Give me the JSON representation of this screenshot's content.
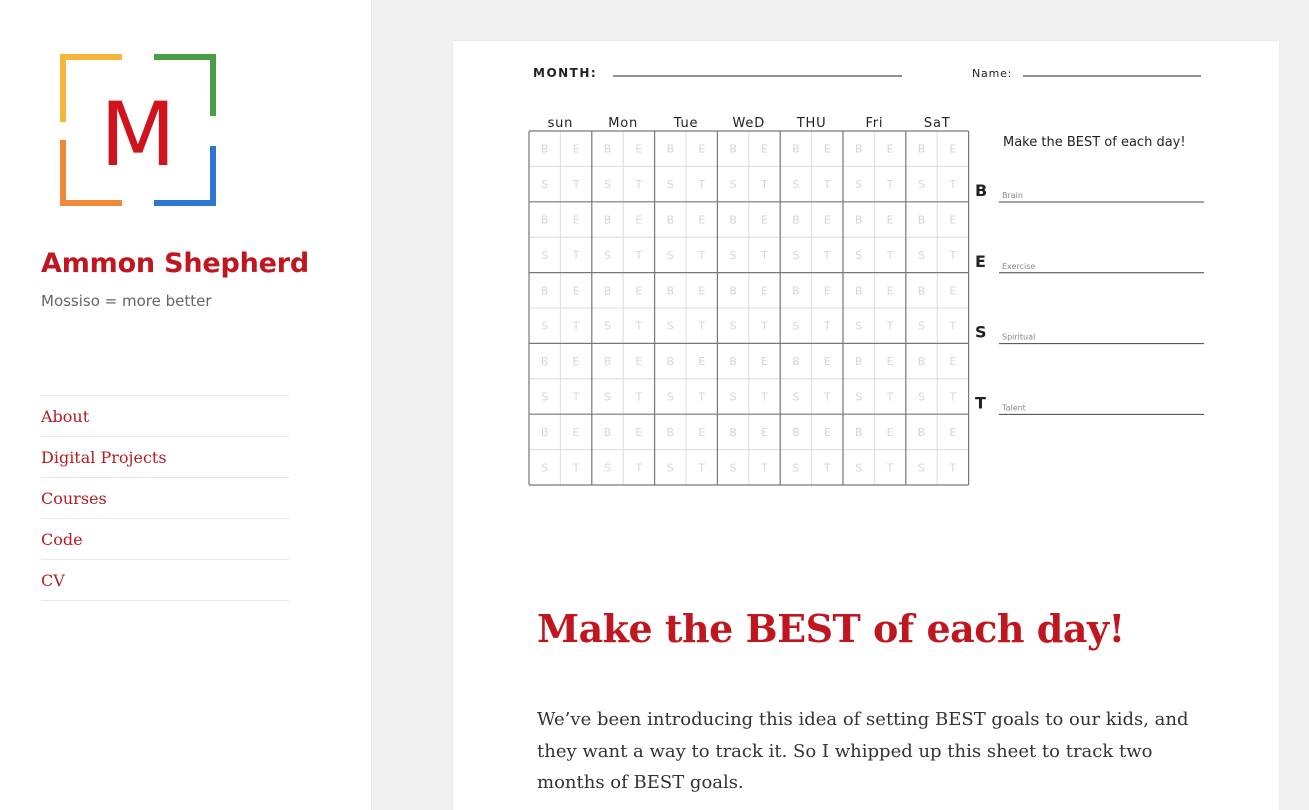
{
  "site": {
    "logo_letter": "M",
    "title": "Ammon Shepherd",
    "description": "Mossiso = more better"
  },
  "menu": [
    {
      "label": "About"
    },
    {
      "label": "Digital Projects"
    },
    {
      "label": "Courses"
    },
    {
      "label": "Code"
    },
    {
      "label": "CV"
    }
  ],
  "sheet": {
    "month_label": "MONTH:",
    "name_label": "Name:",
    "days": [
      "sun",
      "Mon",
      "Tue",
      "WeD",
      "THU",
      "Fri",
      "SaT"
    ],
    "cell_top_letters": [
      "B",
      "E"
    ],
    "cell_bottom_letters": [
      "S",
      "T"
    ],
    "weeks": 5,
    "tagline": "Make the BEST of each day!",
    "goals": [
      {
        "letter": "B",
        "label": "Brain"
      },
      {
        "letter": "E",
        "label": "Exercise"
      },
      {
        "letter": "S",
        "label": "Spiritual"
      },
      {
        "letter": "T",
        "label": "Talent"
      }
    ]
  },
  "post": {
    "title": "Make the BEST of each day!",
    "body": "We’ve been introducing this idea of setting BEST goals to our kids, and they want a way to track it. So I whipped up this sheet to track two months of BEST goals."
  },
  "colors": {
    "brand_red": "#c0161f",
    "logo_yellow": "#f5b73b",
    "logo_green": "#4a9d46",
    "logo_orange": "#ef8a3a",
    "logo_blue": "#2e75d4"
  }
}
